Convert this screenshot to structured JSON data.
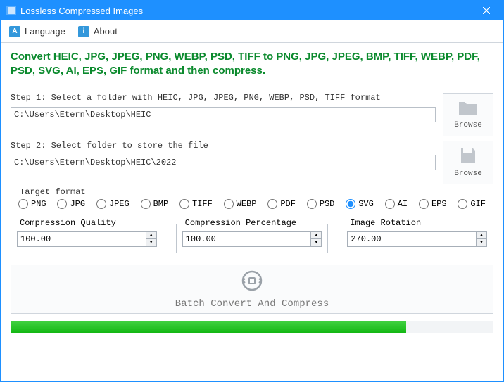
{
  "window": {
    "title": "Lossless Compressed Images"
  },
  "menu": {
    "language": "Language",
    "about": "About"
  },
  "headline": "Convert HEIC, JPG, JPEG, PNG, WEBP, PSD, TIFF to PNG, JPG, JPEG, BMP, TIFF, WEBP, PDF, PSD, SVG, AI, EPS, GIF format and then compress.",
  "step1": {
    "label": "Step 1: Select a folder with HEIC, JPG, JPEG, PNG, WEBP, PSD, TIFF format",
    "path": "C:\\Users\\Etern\\Desktop\\HEIC",
    "browse": "Browse"
  },
  "step2": {
    "label": "Step 2: Select folder to store the file",
    "path": "C:\\Users\\Etern\\Desktop\\HEIC\\2022",
    "browse": "Browse"
  },
  "format": {
    "legend": "Target format",
    "options": [
      "PNG",
      "JPG",
      "JPEG",
      "BMP",
      "TIFF",
      "WEBP",
      "PDF",
      "PSD",
      "SVG",
      "AI",
      "EPS",
      "GIF"
    ],
    "selected": "SVG"
  },
  "quality": {
    "legend": "Compression Quality",
    "value": "100.00"
  },
  "percentage": {
    "legend": "Compression Percentage",
    "value": "100.00"
  },
  "rotation": {
    "legend": "Image Rotation",
    "value": "270.00"
  },
  "batch": {
    "label": "Batch Convert And Compress"
  },
  "progress": {
    "percent": 82
  }
}
